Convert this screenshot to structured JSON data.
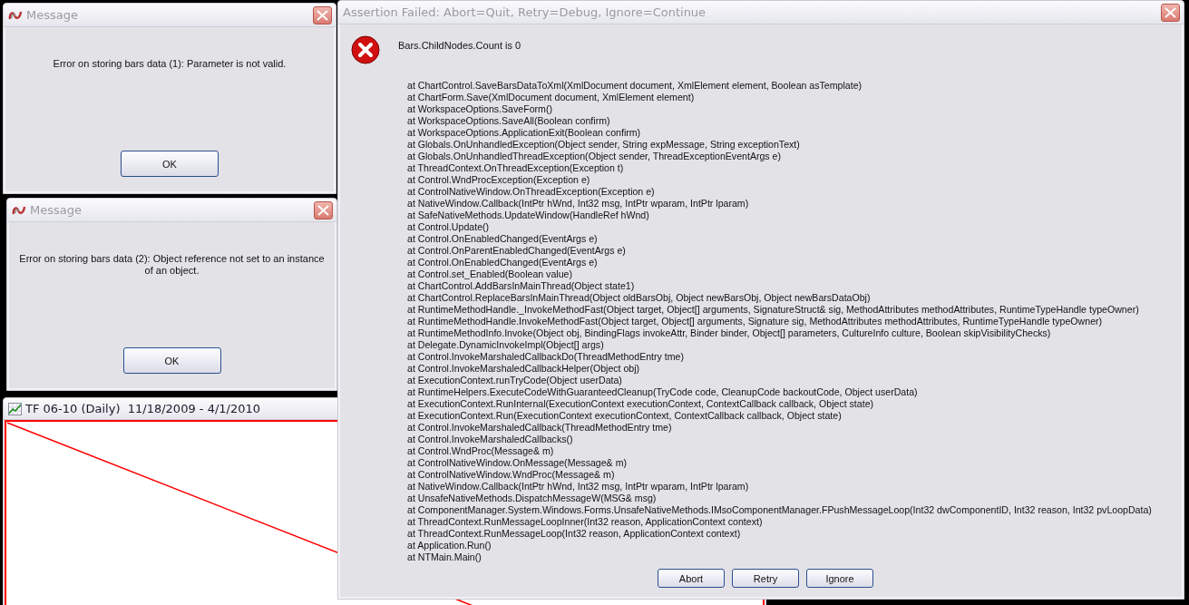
{
  "message_boxes": [
    {
      "title": "Message",
      "text": "Error on storing bars data (1): Parameter is not valid.",
      "button": "OK"
    },
    {
      "title": "Message",
      "text": "Error on storing bars data (2): Object reference not set to an instance of an object.",
      "button": "OK"
    }
  ],
  "chart_window": {
    "title": "TF 06-10 (Daily)  11/18/2009 - 4/1/2010"
  },
  "assertion_dialog": {
    "title": "Assertion Failed: Abort=Quit, Retry=Debug, Ignore=Continue",
    "message": "Bars.ChildNodes.Count is 0",
    "stack_trace": [
      "at ChartControl.SaveBarsDataToXml(XmlDocument document, XmlElement element, Boolean asTemplate)",
      "at ChartForm.Save(XmlDocument document, XmlElement element)",
      "at WorkspaceOptions.SaveForm()",
      "at WorkspaceOptions.SaveAll(Boolean confirm)",
      "at WorkspaceOptions.ApplicationExit(Boolean confirm)",
      "at Globals.OnUnhandledException(Object sender, String expMessage, String exceptionText)",
      "at Globals.OnUnhandledThreadException(Object sender, ThreadExceptionEventArgs e)",
      "at ThreadContext.OnThreadException(Exception t)",
      "at Control.WndProcException(Exception e)",
      "at ControlNativeWindow.OnThreadException(Exception e)",
      "at NativeWindow.Callback(IntPtr hWnd, Int32 msg, IntPtr wparam, IntPtr lparam)",
      "at SafeNativeMethods.UpdateWindow(HandleRef hWnd)",
      "at Control.Update()",
      "at Control.OnEnabledChanged(EventArgs e)",
      "at Control.OnParentEnabledChanged(EventArgs e)",
      "at Control.OnEnabledChanged(EventArgs e)",
      "at Control.set_Enabled(Boolean value)",
      "at ChartControl.AddBarsInMainThread(Object state1)",
      "at ChartControl.ReplaceBarsInMainThread(Object oldBarsObj, Object newBarsObj, Object newBarsDataObj)",
      "at RuntimeMethodHandle._InvokeMethodFast(Object target, Object[] arguments, SignatureStruct& sig, MethodAttributes methodAttributes, RuntimeTypeHandle typeOwner)",
      "at RuntimeMethodHandle.InvokeMethodFast(Object target, Object[] arguments, Signature sig, MethodAttributes methodAttributes, RuntimeTypeHandle typeOwner)",
      "at RuntimeMethodInfo.Invoke(Object obj, BindingFlags invokeAttr, Binder binder, Object[] parameters, CultureInfo culture, Boolean skipVisibilityChecks)",
      "at Delegate.DynamicInvokeImpl(Object[] args)",
      "at Control.InvokeMarshaledCallbackDo(ThreadMethodEntry tme)",
      "at Control.InvokeMarshaledCallbackHelper(Object obj)",
      "at ExecutionContext.runTryCode(Object userData)",
      "at RuntimeHelpers.ExecuteCodeWithGuaranteedCleanup(TryCode code, CleanupCode backoutCode, Object userData)",
      "at ExecutionContext.RunInternal(ExecutionContext executionContext, ContextCallback callback, Object state)",
      "at ExecutionContext.Run(ExecutionContext executionContext, ContextCallback callback, Object state)",
      "at Control.InvokeMarshaledCallback(ThreadMethodEntry tme)",
      "at Control.InvokeMarshaledCallbacks()",
      "at Control.WndProc(Message& m)",
      "at ControlNativeWindow.OnMessage(Message& m)",
      "at ControlNativeWindow.WndProc(Message& m)",
      "at NativeWindow.Callback(IntPtr hWnd, Int32 msg, IntPtr wparam, IntPtr lparam)",
      "at UnsafeNativeMethods.DispatchMessageW(MSG& msg)",
      "at ComponentManager.System.Windows.Forms.UnsafeNativeMethods.IMsoComponentManager.FPushMessageLoop(Int32 dwComponentID, Int32 reason, Int32 pvLoopData)",
      "at ThreadContext.RunMessageLoopInner(Int32 reason, ApplicationContext context)",
      "at ThreadContext.RunMessageLoop(Int32 reason, ApplicationContext context)",
      "at Application.Run()",
      "at NTMain.Main()"
    ],
    "buttons": [
      "Abort",
      "Retry",
      "Ignore"
    ]
  }
}
